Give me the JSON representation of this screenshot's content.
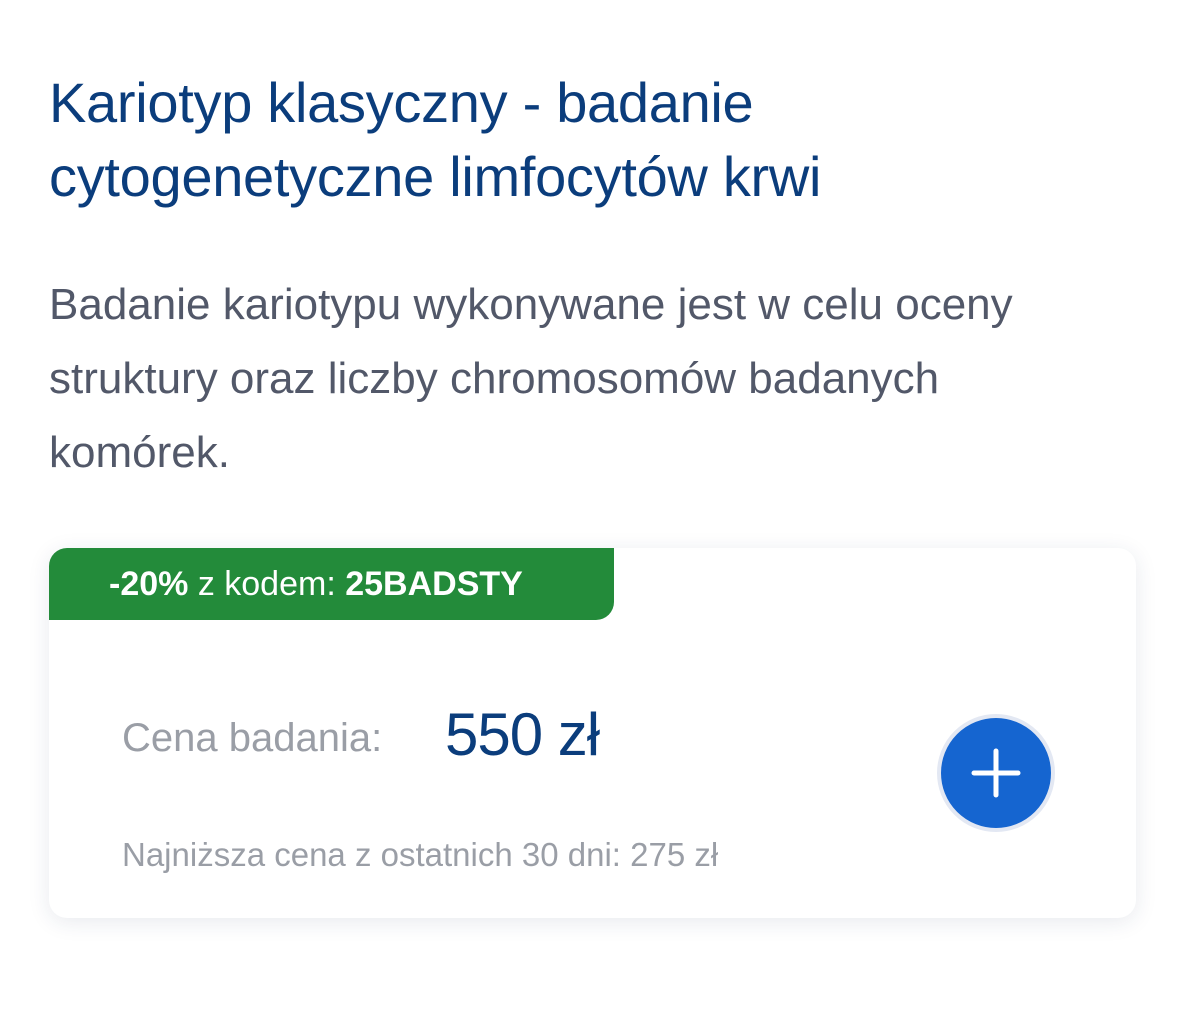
{
  "product": {
    "title": "Kariotyp klasyczny - badanie cytogenetyczne limfocytów krwi",
    "description": "Badanie kariotypu wykonywane jest w celu oceny struktury oraz liczby chromosomów badanych komórek."
  },
  "promo": {
    "discount": "-20%",
    "code_label": " z kodem: ",
    "code": "25BADSTY",
    "color": "#238b3a"
  },
  "price": {
    "label": "Cena badania:",
    "value": "550 zł",
    "lowest_note": "Najniższa cena z ostatnich 30 dni: 275 zł"
  },
  "add_button": {
    "icon": "plus-icon",
    "color": "#1565d0"
  },
  "colors": {
    "title": "#0b3d7c",
    "text": "#525869",
    "muted": "#9a9ea6"
  }
}
